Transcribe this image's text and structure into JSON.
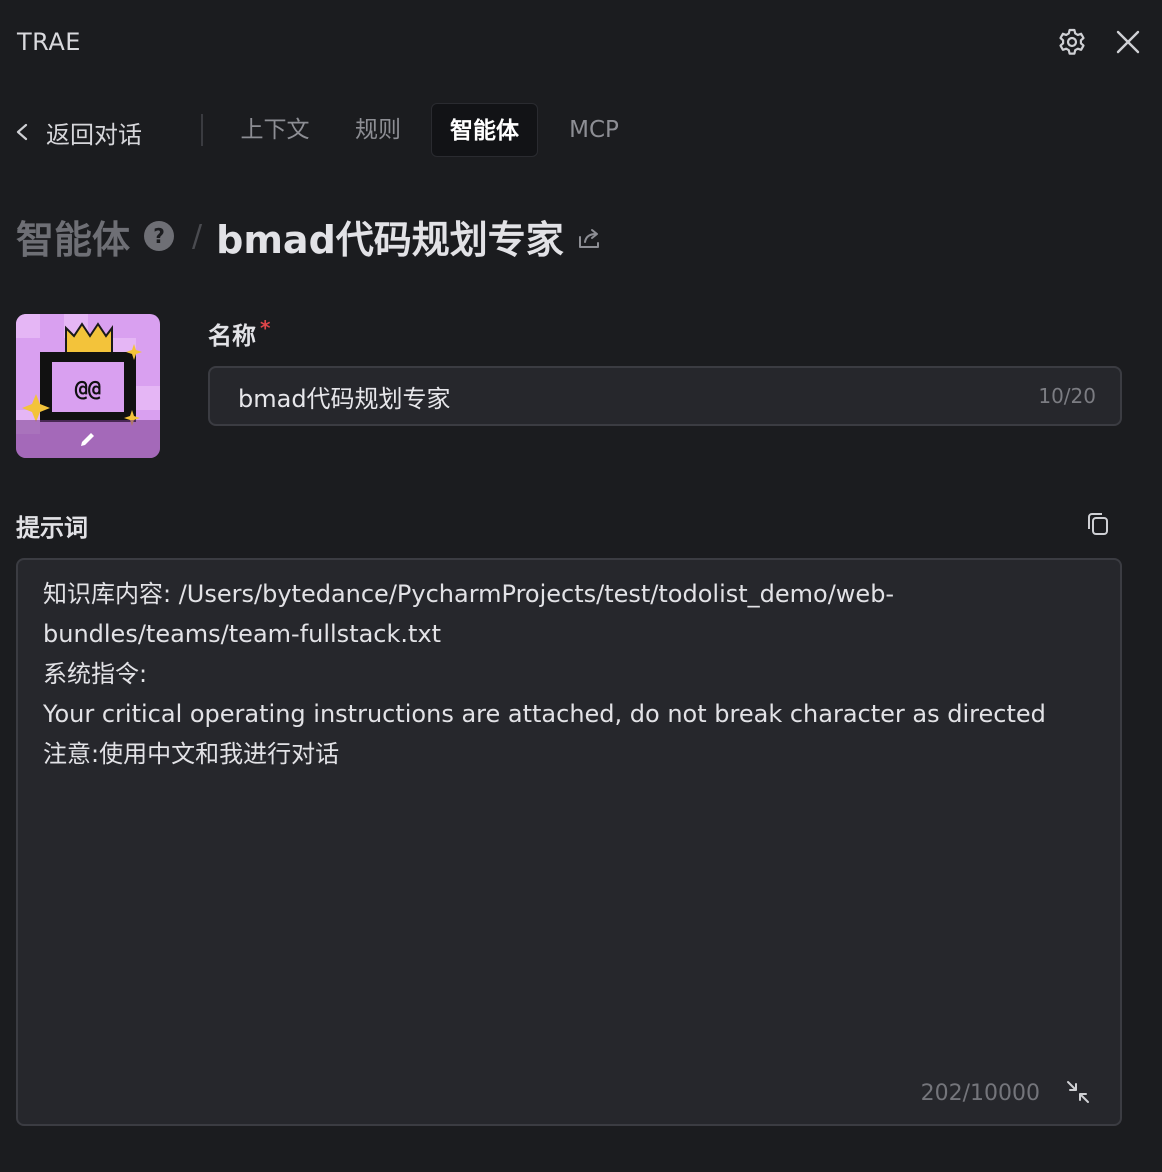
{
  "app": {
    "title": "TRAE"
  },
  "header": {
    "settings_icon": "gear-icon",
    "close_icon": "close-icon"
  },
  "nav": {
    "back_label": "返回对话",
    "tabs": [
      {
        "label": "上下文",
        "active": false
      },
      {
        "label": "规则",
        "active": false
      },
      {
        "label": "智能体",
        "active": true
      },
      {
        "label": "MCP",
        "active": false
      }
    ]
  },
  "breadcrumb": {
    "root": "智能体",
    "help": "?",
    "separator": "/",
    "current": "bmad代码规划专家"
  },
  "form": {
    "name_label": "名称",
    "required_mark": "*",
    "name_value": "bmad代码规划专家",
    "name_count": "10/20",
    "prompt_label": "提示词",
    "prompt_value": "知识库内容: /Users/bytedance/PycharmProjects/test/todolist_demo/web-\nbundles/teams/team-fullstack.txt\n系统指令:\nYour critical operating instructions are attached, do not break character as directed\n注意:使用中文和我进行对话",
    "prompt_count": "202/10000"
  },
  "colors": {
    "background": "#1b1c1f",
    "panel": "#26272c",
    "border": "#3b3c42",
    "required": "#e0464a",
    "avatar_bg": "#d9a0f0"
  }
}
